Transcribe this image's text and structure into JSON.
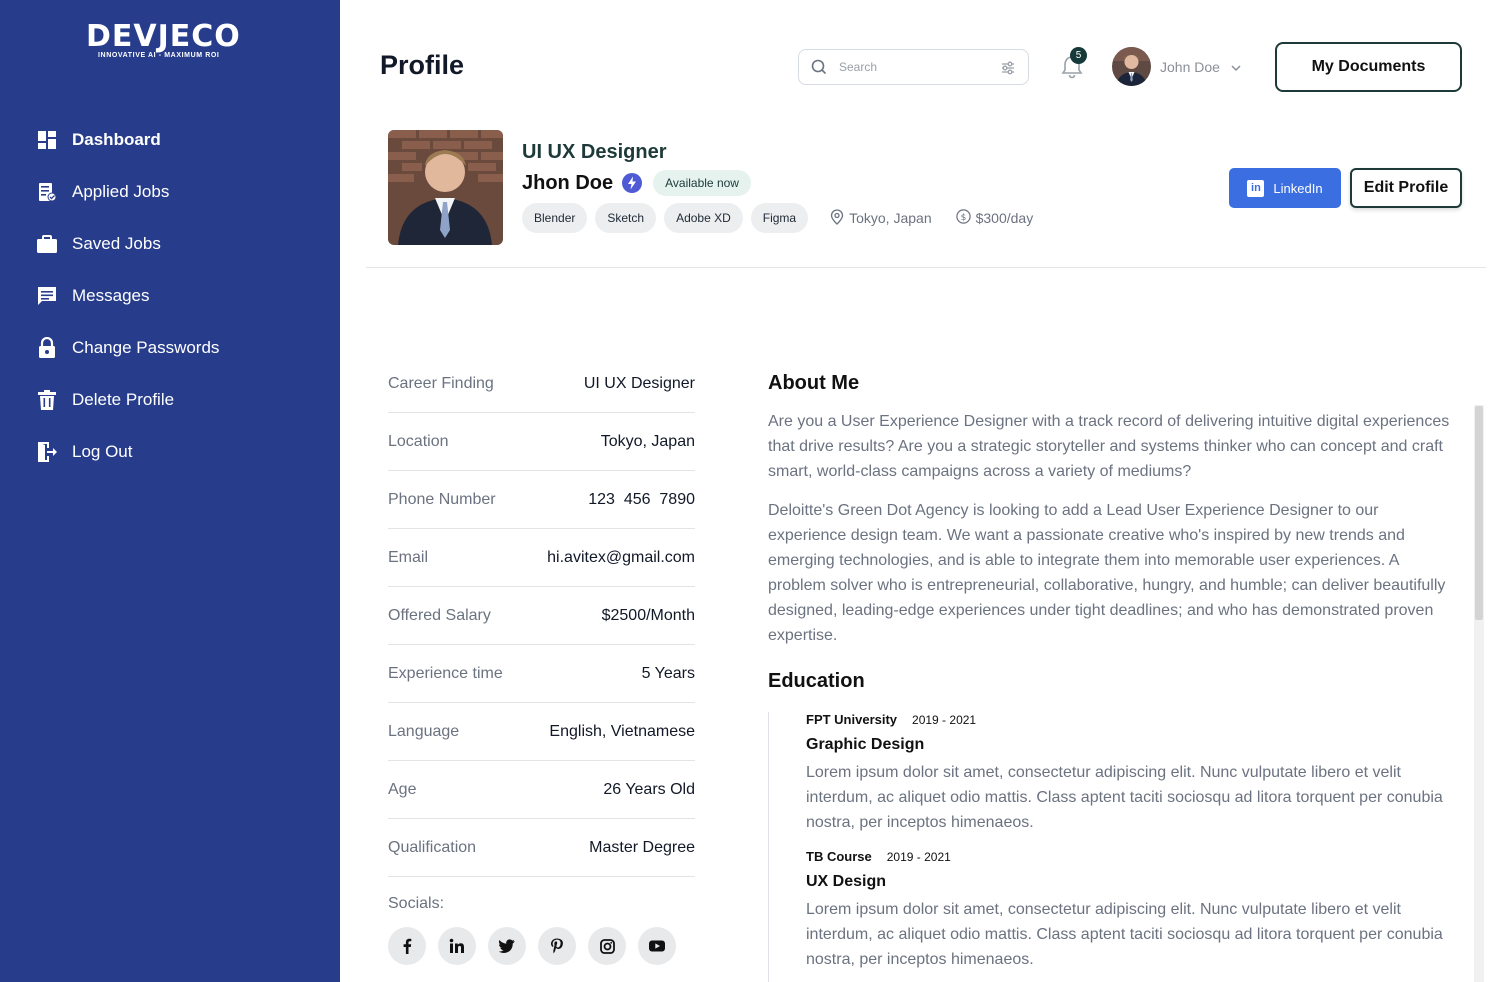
{
  "brand": {
    "name": "DEVJECO",
    "tagline": "INNOVATIVE AI - MAXIMUM ROI"
  },
  "sidebar": {
    "items": [
      {
        "label": "Dashboard",
        "icon": "dashboard-icon",
        "active": true
      },
      {
        "label": "Applied Jobs",
        "icon": "applied-jobs-icon"
      },
      {
        "label": "Saved Jobs",
        "icon": "briefcase-icon"
      },
      {
        "label": "Messages",
        "icon": "message-icon"
      },
      {
        "label": "Change Passwords",
        "icon": "lock-icon"
      },
      {
        "label": "Delete Profile",
        "icon": "trash-icon"
      },
      {
        "label": "Log Out",
        "icon": "logout-icon"
      }
    ]
  },
  "header": {
    "title": "Profile",
    "search_placeholder": "Search",
    "notification_count": "5",
    "user_name": "John Doe",
    "docs_button": "My Documents"
  },
  "profile": {
    "role": "UI UX Designer",
    "name": "Jhon Doe",
    "availability": "Available now",
    "skills": [
      "Blender",
      "Sketch",
      "Adobe XD",
      "Figma"
    ],
    "location": "Tokyo, Japan",
    "rate": "$300/day",
    "linkedin_button": "LinkedIn",
    "edit_button": "Edit Profile"
  },
  "info": [
    {
      "key": "Career Finding",
      "value": "UI UX Designer"
    },
    {
      "key": "Location",
      "value": "Tokyo, Japan"
    },
    {
      "key": "Phone Number",
      "value": "123  456  7890"
    },
    {
      "key": "Email",
      "value": "hi.avitex@gmail.com"
    },
    {
      "key": "Offered Salary",
      "value": "$2500/Month"
    },
    {
      "key": "Experience time",
      "value": "5 Years"
    },
    {
      "key": "Language",
      "value": "English, Vietnamese"
    },
    {
      "key": "Age",
      "value": "26 Years Old"
    },
    {
      "key": "Qualification",
      "value": "Master Degree"
    }
  ],
  "socials": {
    "label": "Socials:",
    "icons": [
      "facebook-icon",
      "linkedin-icon",
      "twitter-icon",
      "pinterest-icon",
      "instagram-icon",
      "youtube-icon"
    ]
  },
  "about": {
    "title": "About Me",
    "paragraphs": [
      "Are you a User Experience Designer with a track record of delivering intuitive digital experiences that drive results? Are you a strategic storyteller and systems thinker who can concept and craft smart, world-class campaigns across a variety of mediums?",
      "Deloitte's Green Dot Agency is looking to add a Lead User Experience Designer to our experience design team. We want a passionate creative who's inspired by new trends and emerging technologies, and is able to integrate them into memorable user experiences. A problem solver who is entrepreneurial, collaborative, hungry, and humble; can deliver beautifully designed, leading-edge experiences under tight deadlines; and who has demonstrated proven expertise."
    ]
  },
  "education": {
    "title": "Education",
    "items": [
      {
        "school": "FPT University",
        "years": "2019 - 2021",
        "degree": "Graphic Design",
        "desc": "Lorem ipsum dolor sit amet, consectetur adipiscing elit. Nunc vulputate libero et velit interdum, ac aliquet odio mattis. Class aptent taciti sociosqu ad litora torquent per conubia nostra, per inceptos himenaeos."
      },
      {
        "school": "TB Course",
        "years": "2019 - 2021",
        "degree": "UX Design",
        "desc": "Lorem ipsum dolor sit amet, consectetur adipiscing elit. Nunc vulputate libero et velit interdum, ac aliquet odio mattis. Class aptent taciti sociosqu ad litora torquent per conubia nostra, per inceptos himenaeos."
      }
    ]
  },
  "colors": {
    "sidebar": "#273d8c",
    "accent": "#1d3a39",
    "linkedin": "#3b6ee0",
    "verified": "#4f5bd5"
  }
}
